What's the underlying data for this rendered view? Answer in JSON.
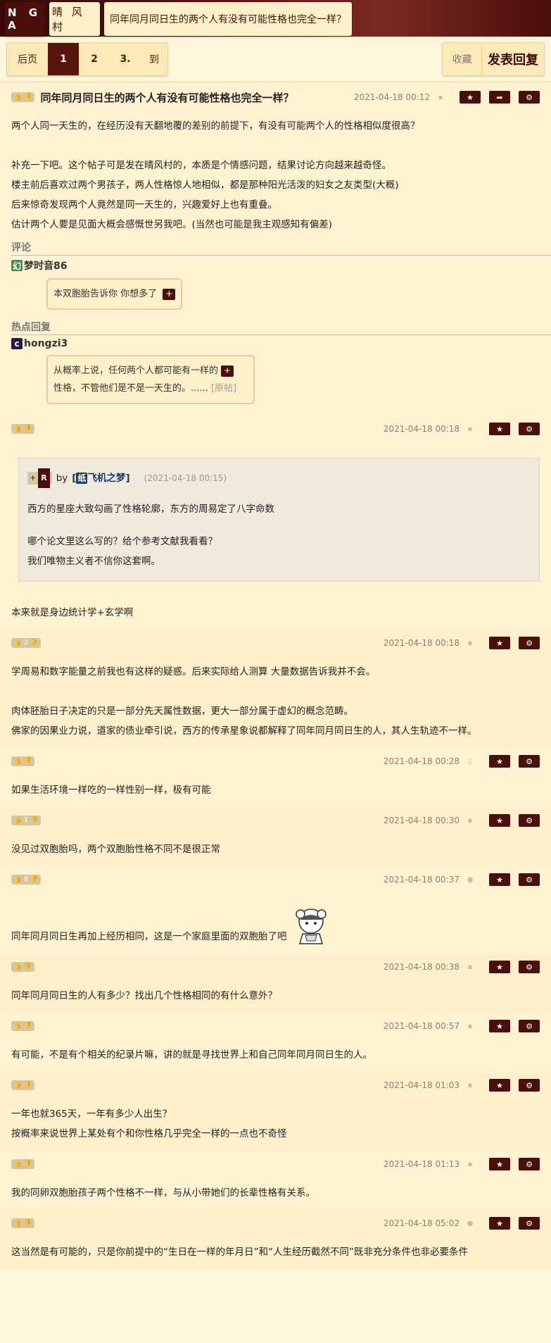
{
  "header": {
    "logo": "N G A",
    "forum": "晴 风 村",
    "title": "同年同月同日生的两个人有没有可能性格也完全一样？"
  },
  "pager": {
    "prev": "后页",
    "pages": [
      "1",
      "2",
      "3."
    ],
    "current": "1",
    "go": "到",
    "favorite": "收藏",
    "reply": "发表回复"
  },
  "main_post": {
    "title": "同年同月同日生的两个人有没有可能性格也完全一样？",
    "time": "2021-04-18 00:12",
    "lines": [
      "两个人同一天生的，在经历没有天翻地覆的差别的前提下，有没有可能两个人的性格相似度很高？",
      "",
      "补充一下吧。这个帖子可是发在晴风村的，本质是个情感问题，结果讨论方向越来越奇怪。",
      "楼主前后喜欢过两个男孩子，两人性格惊人地相似，都是那种阳光活泼的妇女之友类型(大概)",
      "后来惊奇发现两个人竟然是同一天生的，兴趣爱好上也有重叠。",
      "估计两个人要是见面大概会感慨世另我吧。(当然也可能是我主观感知有偏差)"
    ],
    "comments_header": "评论",
    "comment_user_icon": "幻",
    "comment_user": "梦时音86",
    "comment_text": "本双胞胎告诉你 你想多了",
    "hot_header": "热点回复",
    "hot_user_icon": "c",
    "hot_user": "hongzi3",
    "hot_text_1": "从概率上说，任何两个人都可能有一样的",
    "hot_text_2": "性格，不管他们是不是一天生的。......",
    "hot_more": "[原帖]",
    "plus": "+"
  },
  "replies": [
    {
      "likes": "",
      "time": "2021-04-18 00:18",
      "quote": {
        "badge_plus": "+",
        "badge_r": "R",
        "by": "by",
        "user_icon": "纸",
        "user": "飞机之梦",
        "time": "(2021-04-18 00:15)",
        "lines": [
          "西方的星座大致勾画了性格轮廓，东方的周易定了八字命数",
          "",
          "哪个论文里这么写的？给个参考文献我看看？",
          "我们唯物主义者不信你这套啊。"
        ]
      },
      "lines": [
        "本来就是身边统计学+玄学啊"
      ]
    },
    {
      "likes": "2",
      "time": "2021-04-18 00:18",
      "lines": [
        "学周易和数字能量之前我也有这样的疑惑。后来实际给人测算 大量数据告诉我并不会。",
        "",
        "肉体胚胎日子决定的只是一部分先天属性数据，更大一部分属于虚幻的概念范畴。",
        "佛家的因果业力说，道家的债业牵引说，西方的传承星象说都解释了同年同月同日生的人，其人生轨迹不一样。"
      ]
    },
    {
      "likes": "",
      "time": "2021-04-18 00:28",
      "lines": [
        "如果生活环境一样吃的一样性别一样，极有可能"
      ]
    },
    {
      "likes": "1",
      "time": "2021-04-18 00:30",
      "lines": [
        "没见过双胞胎吗，两个双胞胎性格不同不是很正常"
      ]
    },
    {
      "likes": "8",
      "time": "2021-04-18 00:37",
      "lines": [
        "同年同月同日生再加上经历相同，这是一个家庭里面的双胞胎了吧"
      ],
      "sticker": true
    },
    {
      "likes": "",
      "time": "2021-04-18 00:38",
      "lines": [
        "同年同月同日生的人有多少？找出几个性格相同的有什么意外？"
      ]
    },
    {
      "likes": "",
      "time": "2021-04-18 00:57",
      "lines": [
        "有可能，不是有个相关的纪录片嘛，讲的就是寻找世界上和自己同年同月同日生的人。"
      ]
    },
    {
      "likes": "",
      "time": "2021-04-18 01:03",
      "lines": [
        "一年也就365天，一年有多少人出生？",
        "按概率来说世界上某处有个和你性格几乎完全一样的一点也不奇怪"
      ]
    },
    {
      "likes": "",
      "time": "2021-04-18 01:13",
      "lines": [
        "我的同卵双胞胎孩子两个性格不一样，与从小带她们的长辈性格有关系。"
      ]
    },
    {
      "likes": "",
      "time": "2021-04-18 05:02",
      "lines": [
        "这当然是有可能的，只是你前提中的“生日在一样的年月日”和“人生经历截然不同”既非充分条件也非必要条件"
      ]
    }
  ]
}
